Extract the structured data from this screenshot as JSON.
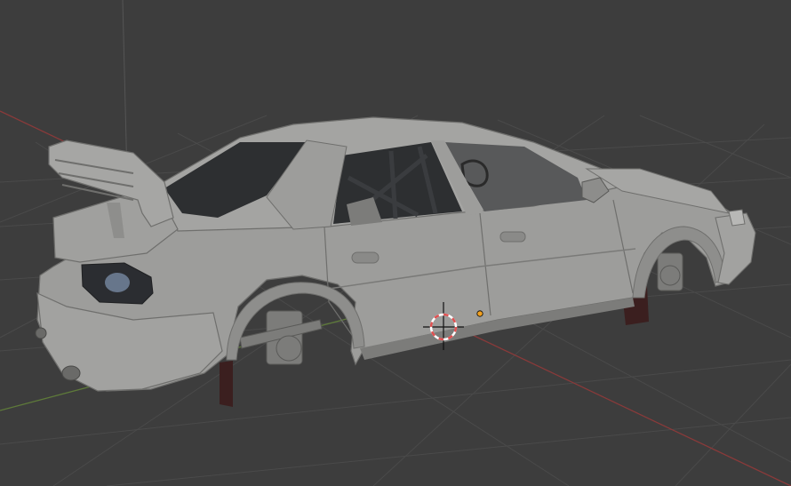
{
  "viewport": {
    "background_color": "#3d3d3d",
    "grid_color": "#4a4a4a",
    "x_axis_color": "#8a3a3a",
    "y_axis_color": "#5e7a3a",
    "z_axis_color": "#555555"
  },
  "model": {
    "body_color": "#9d9d9b",
    "shadow_color": "#6f6f6d",
    "glass_color": "#2d2f31",
    "interior_color": "#7c7c7a",
    "mudflap_color": "#3b1f1f"
  },
  "cursor": {
    "icon": "3d-cursor-icon",
    "ring_color": "#e05050",
    "ring_alt_color": "#ffffff"
  },
  "origin": {
    "icon": "object-origin-icon",
    "color": "#f0a020"
  }
}
